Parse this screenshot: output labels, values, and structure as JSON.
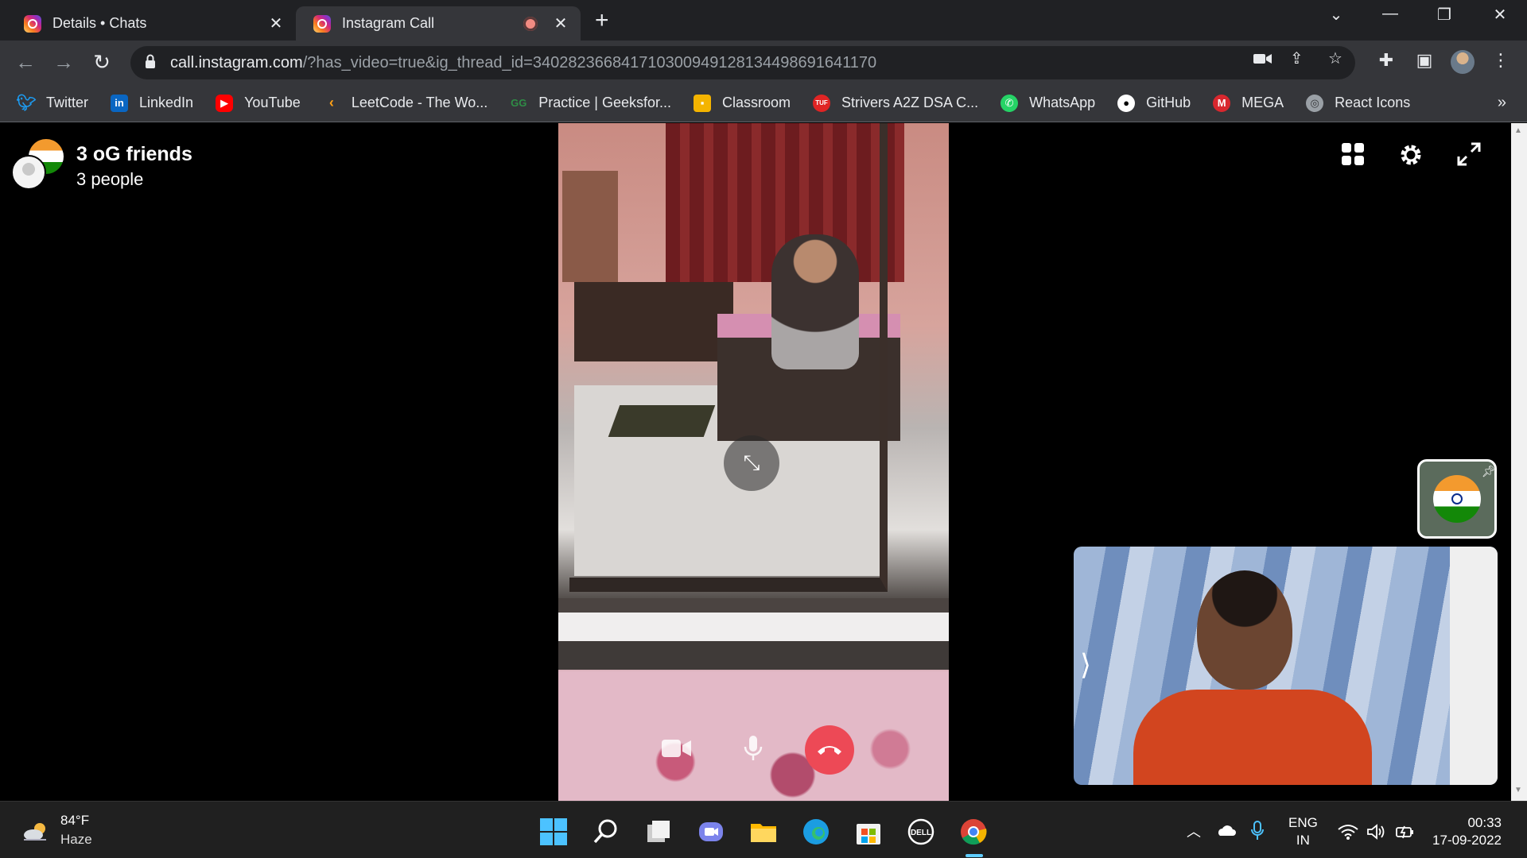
{
  "browser": {
    "tabs": [
      {
        "title": "Details • Chats",
        "active": false
      },
      {
        "title": "Instagram Call",
        "active": true
      }
    ],
    "url": {
      "host": "call.instagram.com",
      "path": "/?has_video=true&ig_thread_id=340282366841710300949128134498691641170"
    },
    "bookmarks": [
      {
        "label": "Twitter",
        "icon": "twitter-icon",
        "color": "#1d9bf0"
      },
      {
        "label": "LinkedIn",
        "icon": "linkedin-icon",
        "color": "#0a66c2"
      },
      {
        "label": "YouTube",
        "icon": "youtube-icon",
        "color": "#ff0000"
      },
      {
        "label": "LeetCode - The Wo...",
        "icon": "leetcode-icon",
        "color": "#ffa116"
      },
      {
        "label": "Practice | Geeksfor...",
        "icon": "geeksforgeeks-icon",
        "color": "#2f8d46"
      },
      {
        "label": "Classroom",
        "icon": "classroom-icon",
        "color": "#f4b400"
      },
      {
        "label": "Strivers A2Z DSA C...",
        "icon": "tuf-icon",
        "color": "#e02424"
      },
      {
        "label": "WhatsApp",
        "icon": "whatsapp-icon",
        "color": "#25d366"
      },
      {
        "label": "GitHub",
        "icon": "github-icon",
        "color": "#ffffff"
      },
      {
        "label": "MEGA",
        "icon": "mega-icon",
        "color": "#d9272e"
      },
      {
        "label": "React Icons",
        "icon": "react-icons-icon",
        "color": "#9aa0a6"
      }
    ],
    "bookmarks_more": "»"
  },
  "call": {
    "group_name": "3 oG friends",
    "participants": "3 people",
    "accent_end_call": "#ed4956"
  },
  "taskbar": {
    "weather_temp": "84°F",
    "weather_desc": "Haze",
    "language": "ENG",
    "region": "IN",
    "time": "00:33",
    "date": "17-09-2022"
  }
}
